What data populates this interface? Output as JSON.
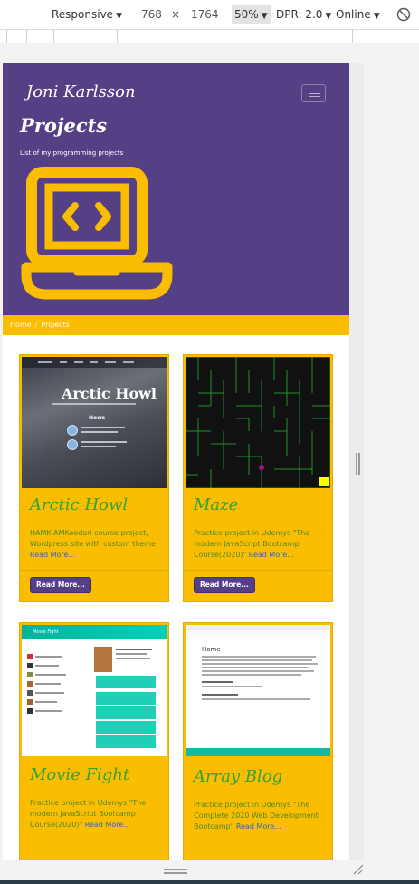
{
  "devtools": {
    "device": "Responsive",
    "width": "768",
    "times": "×",
    "height": "1764",
    "zoom": "50%",
    "dpr": "DPR: 2.0",
    "throttle": "Online",
    "rotate_icon": "rotate-icon"
  },
  "site": {
    "brand": "Joni Karlsson",
    "hero_title": "Projects",
    "hero_subtitle": "List of my programming projects",
    "breadcrumb": {
      "home": "Home",
      "separator": "/",
      "current": "Projects"
    },
    "colors": {
      "purple": "#553f85",
      "yellow": "#fbbd00",
      "green": "#36a13b",
      "link": "#2a67c9"
    },
    "projects": [
      {
        "title": "Arctic Howl",
        "desc": "HAMK AMKoodari course project, Wordpress site with custom theme",
        "more": "Read More...",
        "button": "Read More...",
        "thumb": {
          "heading": "Arctic Howl",
          "news": "News"
        }
      },
      {
        "title": "Maze",
        "desc": "Practice project in Udemys \"The modern JavaScript Bootcamp Course(2020)\"",
        "more": "Read More...",
        "button": "Read More..."
      },
      {
        "title": "Movie Fight",
        "desc": "Practice project in Udemys \"The modern JavaScript Bootcamp Course(2020)\"",
        "more": "Read More...",
        "thumb": {
          "bar": "Movie Fight"
        }
      },
      {
        "title": "Array Blog",
        "desc": "Practice project in Udemys \"The Complete 2020 Web Development Bootcamp\"",
        "more": "Read More...",
        "thumb": {
          "heading": "Home"
        }
      }
    ]
  }
}
